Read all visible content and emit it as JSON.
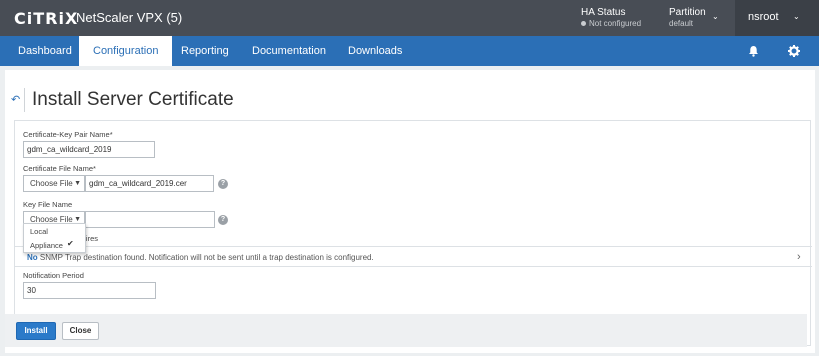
{
  "header": {
    "logo": "CiTRiX",
    "product": "NetScaler VPX (5)",
    "ha_status_label": "HA Status",
    "ha_status_value": "Not configured",
    "partition_label": "Partition",
    "partition_value": "default",
    "user": "nsroot"
  },
  "nav": {
    "tabs": [
      {
        "label": "Dashboard"
      },
      {
        "label": "Configuration"
      },
      {
        "label": "Reporting"
      },
      {
        "label": "Documentation"
      },
      {
        "label": "Downloads"
      }
    ],
    "active": "Configuration",
    "icons": [
      "bell-icon",
      "gear-icon"
    ]
  },
  "page": {
    "back_icon": "back-arrow-icon",
    "title": "Install Server Certificate"
  },
  "form": {
    "cert_key_label": "Certificate-Key Pair Name*",
    "cert_key_value": "gdm_ca_wildcard_2019",
    "cert_file_label": "Certificate File Name*",
    "cert_file_choose": "Choose File",
    "cert_file_value": "gdm_ca_wildcard_2019.cer",
    "key_file_label": "Key File Name",
    "key_file_choose": "Choose File",
    "key_file_value": "",
    "dropdown_options": [
      "Local",
      "Appliance"
    ],
    "dropdown_selected": "Appliance",
    "expires_partial": "Expires",
    "notice_prefix": "No",
    "notice_text": " SNMP Trap destination found. Notification will not be sent until a trap destination is configured.",
    "notification_label": "Notification Period",
    "notification_value": "30"
  },
  "footer": {
    "install": "Install",
    "close": "Close"
  },
  "colors": {
    "header_bg": "#484d55",
    "nav_bg": "#2b6fb6",
    "primary_button": "#2b7ac9"
  }
}
